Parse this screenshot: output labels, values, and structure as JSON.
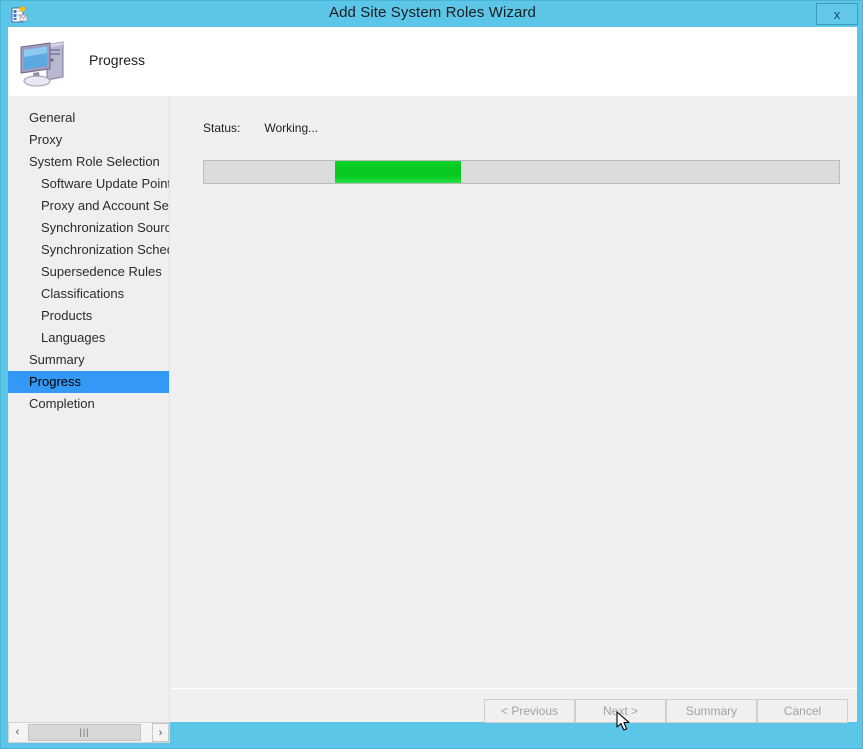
{
  "window": {
    "title": "Add Site System Roles Wizard",
    "title_icon": "site-system-roles-icon",
    "close_label": "x"
  },
  "header": {
    "title": "Progress",
    "icon": "computer-icon"
  },
  "sidebar": {
    "items": [
      {
        "label": "General",
        "indent": false,
        "selected": false
      },
      {
        "label": "Proxy",
        "indent": false,
        "selected": false
      },
      {
        "label": "System Role Selection",
        "indent": false,
        "selected": false
      },
      {
        "label": "Software Update Point",
        "indent": true,
        "selected": false
      },
      {
        "label": "Proxy and Account Settings",
        "indent": true,
        "selected": false
      },
      {
        "label": "Synchronization Source",
        "indent": true,
        "selected": false
      },
      {
        "label": "Synchronization Schedule",
        "indent": true,
        "selected": false
      },
      {
        "label": "Supersedence Rules",
        "indent": true,
        "selected": false
      },
      {
        "label": "Classifications",
        "indent": true,
        "selected": false
      },
      {
        "label": "Products",
        "indent": true,
        "selected": false
      },
      {
        "label": "Languages",
        "indent": true,
        "selected": false
      },
      {
        "label": "Summary",
        "indent": false,
        "selected": false
      },
      {
        "label": "Progress",
        "indent": false,
        "selected": true
      },
      {
        "label": "Completion",
        "indent": false,
        "selected": false
      }
    ]
  },
  "content": {
    "status_label": "Status:",
    "status_value": "Working...",
    "progress": {
      "style": "marquee",
      "chunk_left_percent": 20.7,
      "chunk_width_percent": 19.8,
      "fill_color": "#06c61f",
      "track_color": "#dcdcdc"
    }
  },
  "footer": {
    "previous_label": "< Previous",
    "next_label": "Next >",
    "summary_label": "Summary",
    "cancel_label": "Cancel"
  },
  "scrollbar": {
    "left_arrow": "‹",
    "right_arrow": "›",
    "thumb_grip": "|||"
  },
  "colors": {
    "title_bar": "#5bc6e8",
    "selection": "#3399f5",
    "body": "#f0f0f0",
    "sidebar": "#efefef",
    "progress_green": "#06c61f"
  }
}
